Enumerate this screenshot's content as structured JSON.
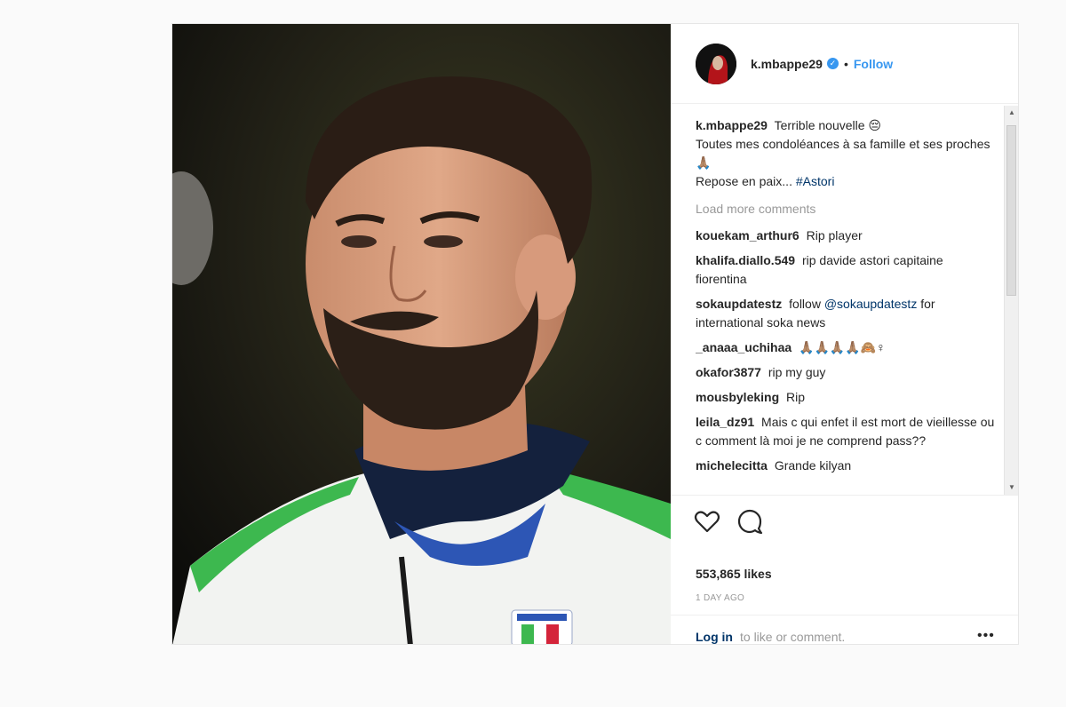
{
  "header": {
    "username": "k.mbappe29",
    "separator": "•",
    "follow_label": "Follow",
    "verified_glyph": "✓"
  },
  "caption": {
    "user": "k.mbappe29",
    "line1": "Terrible nouvelle 😔",
    "line2": "Toutes mes condoléances à sa famille et ses proches 🙏🏽",
    "line3_text": "Repose en paix...",
    "line3_tag": "#Astori"
  },
  "load_more": "Load more comments",
  "comments": [
    {
      "user": "kouekam_arthur6",
      "text": "Rip player"
    },
    {
      "user": "khalifa.diallo.549",
      "text": "rip davide astori capitaine fiorentina"
    },
    {
      "user": "sokaupdatestz",
      "text_before": "follow",
      "mention": "@sokaupdatestz",
      "text_after": "for international soka news"
    },
    {
      "user": "_anaaa_uchihaa",
      "text": "🙏🏽🙏🏽🙏🏽🙏🏽🙈♀"
    },
    {
      "user": "okafor3877",
      "text": "rip my guy"
    },
    {
      "user": "mousbyleking",
      "text": "Rip"
    },
    {
      "user": "leila_dz91",
      "text": "Mais c qui enfet il est mort de vieillesse ou c comment là moi je ne comprend pass??"
    },
    {
      "user": "michelecitta",
      "text": "Grande kilyan"
    }
  ],
  "scrollbar": {
    "up": "▲",
    "down": "▼"
  },
  "likes": "553,865 likes",
  "time": "1 DAY AGO",
  "login": {
    "link": "Log in",
    "text": "to like or comment.",
    "more": "•••"
  },
  "icons": {
    "like": "heart-icon",
    "comment": "comment-bubble-icon",
    "options": "more-options-icon"
  },
  "colors": {
    "link_blue": "#3897f0",
    "dark_link": "#003569",
    "muted": "#999999",
    "jersey_green": "#3db84f"
  }
}
